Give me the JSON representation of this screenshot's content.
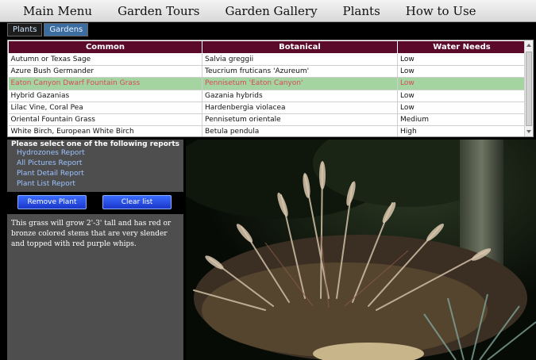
{
  "nav": {
    "items": [
      "Main Menu",
      "Garden Tours",
      "Garden Gallery",
      "Plants",
      "How to Use"
    ]
  },
  "tabs": [
    {
      "label": "Plants",
      "active": true
    },
    {
      "label": "Gardens",
      "active": false
    }
  ],
  "table": {
    "headers": [
      "Common",
      "Botanical",
      "Water Needs"
    ],
    "rows": [
      [
        "Autumn or Texas Sage",
        "Salvia greggii",
        "Low"
      ],
      [
        "Azure Bush Germander",
        "Teucrium fruticans 'Azureum'",
        "Low"
      ],
      [
        "Eaton Canyon Dwarf Fountain Grass",
        "Pennisetum 'Eaton Canyon'",
        "Low"
      ],
      [
        "Hybrid Gazanias",
        "Gazania hybrids",
        "Low"
      ],
      [
        "Lilac Vine, Coral Pea",
        "Hardenbergia violacea",
        "Low"
      ],
      [
        "Oriental Fountain Grass",
        "Pennisetum orientale",
        "Medium"
      ],
      [
        "White Birch, European White Birch",
        "Betula pendula",
        "High"
      ]
    ],
    "selected_row": 2
  },
  "reports": {
    "header": "Please select one of the following reports",
    "links": [
      "Hydrozones Report",
      "All Pictures Report",
      "Plant Detail Report",
      "Plant List Report"
    ]
  },
  "buttons": {
    "remove": "Remove Plant",
    "clear": "Clear list"
  },
  "description": "This grass will grow 2'-3' tall and has red or bronze colored stems that are very slender and topped with red purple whips.",
  "colors": {
    "header_bg": "#5b0a2a",
    "selected_row_bg": "#a4d4a0",
    "selected_row_text": "#d84a58",
    "link": "#9cc3ff",
    "button": "#1a37c9"
  }
}
